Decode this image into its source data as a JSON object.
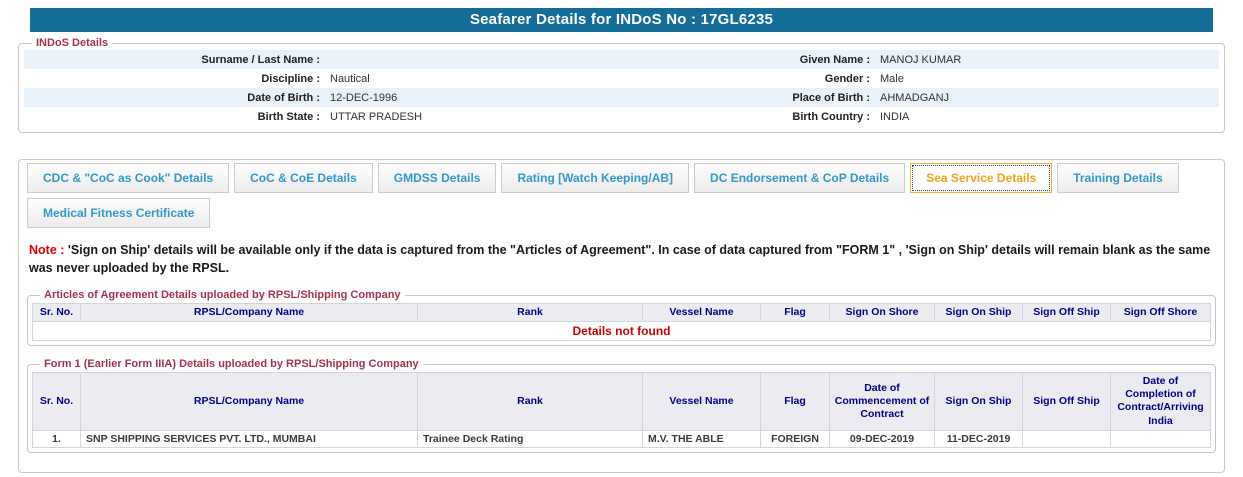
{
  "colors": {
    "title_bar_bg": "#146c99",
    "title_text": "#ffffff",
    "legend_red": "#a3334d",
    "tab_text_blue": "#3399cc",
    "tab_active_orange": "#f5a11c",
    "table_header_text": "#00008b",
    "table_header_bg": "#ebebf1",
    "alert_red": "#e00000",
    "row_stripe_blue": "#e9f1f9"
  },
  "title_bar": {
    "title": "Seafarer Details for INDoS No : 17GL6235"
  },
  "indos": {
    "legend": "INDoS Details",
    "rows": [
      {
        "l1": "Surname / Last Name :",
        "v1": "",
        "l2": "Given Name :",
        "v2": "MANOJ KUMAR"
      },
      {
        "l1": "Discipline :",
        "v1": "Nautical",
        "l2": "Gender :",
        "v2": "Male"
      },
      {
        "l1": "Date of Birth :",
        "v1": "12-DEC-1996",
        "l2": "Place of Birth :",
        "v2": "AHMADGANJ"
      },
      {
        "l1": "Birth State :",
        "v1": "UTTAR PRADESH",
        "l2": "Birth Country :",
        "v2": "INDIA"
      }
    ]
  },
  "tabs": {
    "active": "Sea Service Details",
    "row1": [
      "CDC & \"CoC as Cook\" Details",
      "CoC & CoE Details",
      "GMDSS Details",
      "Rating [Watch Keeping/AB]",
      "DC Endorsement & CoP Details",
      "Sea Service Details",
      "Training Details"
    ],
    "row2": [
      "Medical Fitness Certificate"
    ]
  },
  "note": {
    "prefix": "Note :",
    "text": "'Sign on Ship' details will be available only if the data is captured from the \"Articles of Agreement\". In case of data captured from \"FORM 1\" , 'Sign on Ship' details will remain blank as the same was never uploaded by the RPSL."
  },
  "articles_table": {
    "legend": "Articles of Agreement Details uploaded by RPSL/Shipping Company",
    "headers": [
      "Sr. No.",
      "RPSL/Company Name",
      "Rank",
      "Vessel Name",
      "Flag",
      "Sign On Shore",
      "Sign On Ship",
      "Sign Off Ship",
      "Sign Off Shore"
    ],
    "empty_message": "Details not found"
  },
  "form1_table": {
    "legend": "Form 1 (Earlier Form IIIA) Details uploaded by RPSL/Shipping Company",
    "headers": [
      "Sr. No.",
      "RPSL/Company Name",
      "Rank",
      "Vessel Name",
      "Flag",
      "Date of Commencement of Contract",
      "Sign On Ship",
      "Sign Off Ship",
      "Date of Completion of Contract/Arriving India"
    ],
    "rows": [
      [
        "1.",
        "SNP SHIPPING SERVICES PVT. LTD., MUMBAI",
        "Trainee Deck Rating",
        "M.V. THE ABLE",
        "FOREIGN",
        "09-DEC-2019",
        "11-DEC-2019",
        "",
        ""
      ]
    ]
  }
}
